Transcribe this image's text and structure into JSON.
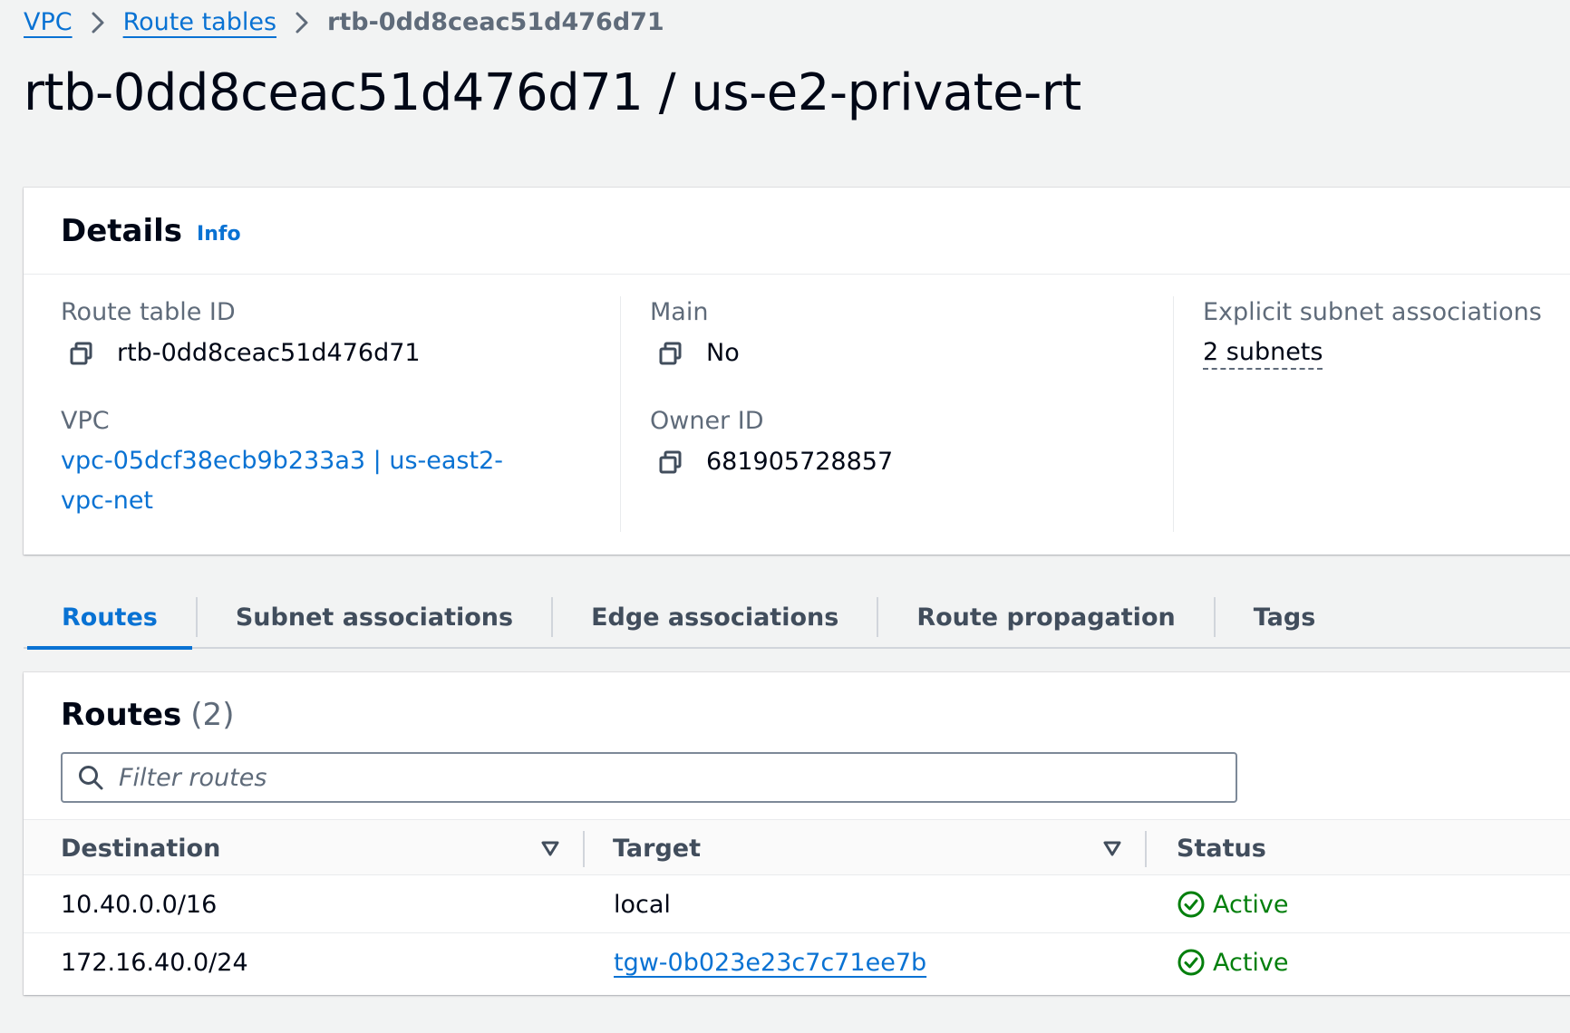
{
  "breadcrumb": {
    "items": [
      {
        "label": "VPC"
      },
      {
        "label": "Route tables"
      }
    ],
    "current": "rtb-0dd8ceac51d476d71"
  },
  "page_title": "rtb-0dd8ceac51d476d71 / us-e2-private-rt",
  "details": {
    "heading": "Details",
    "info_link": "Info",
    "route_table_id": {
      "label": "Route table ID",
      "value": "rtb-0dd8ceac51d476d71"
    },
    "vpc": {
      "label": "VPC",
      "value": "vpc-05dcf38ecb9b233a3 | us-east2-vpc-net"
    },
    "main": {
      "label": "Main",
      "value": "No"
    },
    "owner_id": {
      "label": "Owner ID",
      "value": "681905728857"
    },
    "explicit_subnets": {
      "label": "Explicit subnet associations",
      "value": "2 subnets"
    }
  },
  "tabs": [
    {
      "label": "Routes",
      "active": true
    },
    {
      "label": "Subnet associations",
      "active": false
    },
    {
      "label": "Edge associations",
      "active": false
    },
    {
      "label": "Route propagation",
      "active": false
    },
    {
      "label": "Tags",
      "active": false
    }
  ],
  "routes": {
    "heading": "Routes",
    "count": "(2)",
    "filter_placeholder": "Filter routes",
    "columns": [
      "Destination",
      "Target",
      "Status"
    ],
    "rows": [
      {
        "destination": "10.40.0.0/16",
        "target": "local",
        "target_is_link": false,
        "status": "Active"
      },
      {
        "destination": "172.16.40.0/24",
        "target": "tgw-0b023e23c7c71ee7b",
        "target_is_link": true,
        "status": "Active"
      }
    ]
  },
  "colors": {
    "link": "#0972d3",
    "success": "#037f0c",
    "text": "#000716",
    "muted": "#5f6b7a"
  },
  "icons": [
    "chevron-right-icon",
    "copy-icon",
    "search-icon",
    "sort-caret-down-icon",
    "status-positive-icon"
  ]
}
